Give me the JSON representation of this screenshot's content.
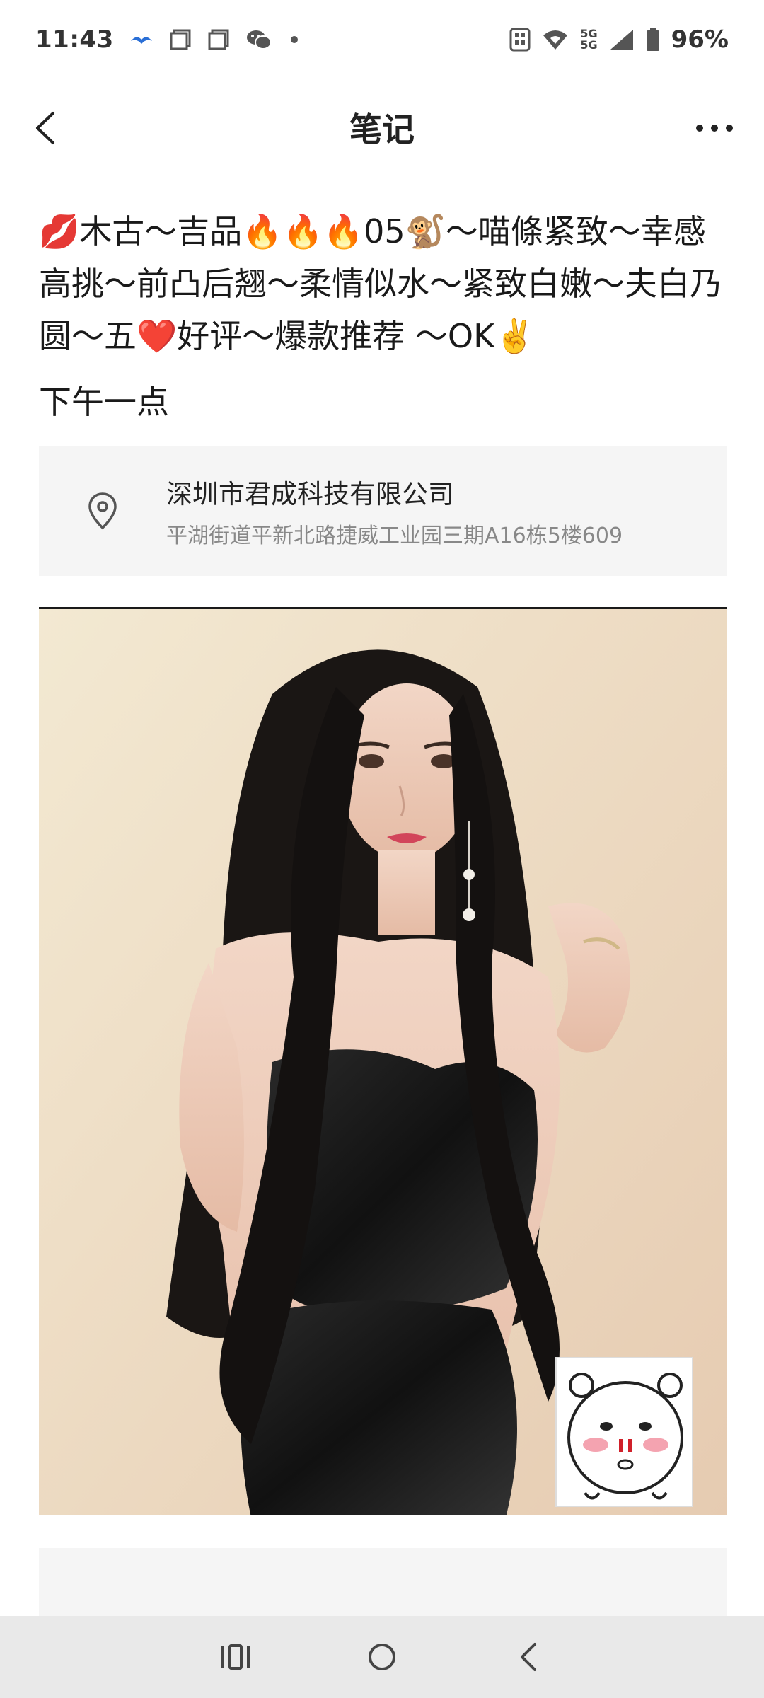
{
  "status_bar": {
    "time": "11:43",
    "battery": "96%",
    "network_top": "5G",
    "network_bottom": "5G",
    "icons": [
      "bird-icon",
      "square-icon",
      "square-icon",
      "wechat-icon",
      "dot-icon",
      "nfc-icon",
      "wifi-icon",
      "signal-icon",
      "battery-icon"
    ]
  },
  "header": {
    "title": "笔记",
    "back_icon": "chevron-left-icon",
    "more_icon": "more-horizontal-icon"
  },
  "post": {
    "text": "💋木古～吉品🔥🔥🔥05🐒～喵條紧致～幸感高挑～前凸后翘～柔情似水～紧致白嫩～夫白乃圆～五❤️好评～爆款推荐 ～OK✌️",
    "subtext": "下午一点"
  },
  "location": {
    "name": "深圳市君成科技有限公司",
    "address": "平湖街道平新北路捷威工业园三期A16栋5楼609",
    "icon": "location-pin-icon"
  },
  "photo": {
    "description_icon": "photo-image"
  },
  "nav_bar": {
    "icons": [
      "recent-apps-icon",
      "home-icon",
      "back-icon"
    ]
  }
}
